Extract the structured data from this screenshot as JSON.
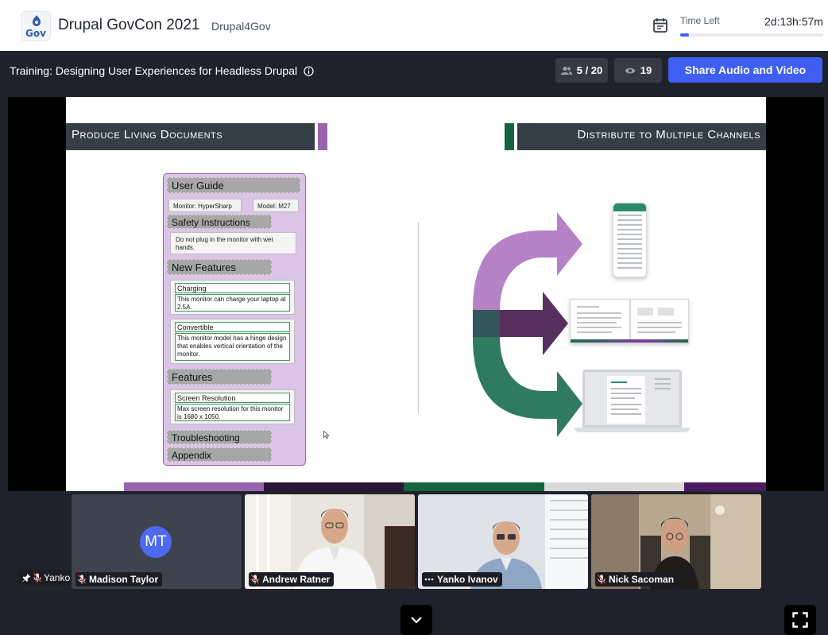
{
  "header": {
    "logo_text": "Gov",
    "event_title": "Drupal GovCon 2021",
    "organizer": "Drupal4Gov",
    "time_left_label": "Time Left",
    "time_left_value": "2d:13h:57m",
    "time_elapsed_fraction": 0.06
  },
  "session": {
    "title": "Training: Designing User Experiences for Headless Drupal",
    "participants": "5 / 20",
    "viewers": "19",
    "share_button": "Share Audio and Video"
  },
  "slide": {
    "left_heading": "Produce Living Documents",
    "right_heading": "Distribute to Multiple Channels",
    "doc": {
      "user_guide": "User Guide",
      "monitor_chip": "Monitor: HyperSharp",
      "model_chip": "Model: M27",
      "safety": "Safety Instructions",
      "safety_text": "Do not plug in the monitor with wet hands.",
      "new_features": "New Features",
      "charging_title": "Charging",
      "charging_text": "This monitor can charge your laptop at 2.5A.",
      "convertible_title": "Convertible",
      "convertible_text": "This monitor model has a hinge design that enables vertical orientation of the monitor.",
      "features": "Features",
      "resolution_title": "Screen Resolution",
      "resolution_text": "Max screen resolution for this monitor is 1680 x 1050.",
      "troubleshooting": "Troubleshooting",
      "appendix": "Appendix"
    },
    "colors": {
      "purple": "#9a63ad",
      "green": "#14653f",
      "dark": "#333f44"
    }
  },
  "stage_label": "Yanko Ivanov [Screenshare]",
  "participants": [
    {
      "name": "Madison Taylor",
      "initials": "MT",
      "indicator": "mic-muted-icon"
    },
    {
      "name": "Andrew Ratner",
      "indicator": "mic-muted-icon"
    },
    {
      "name": "Yanko Ivanov",
      "indicator": "speaking-dots-icon"
    },
    {
      "name": "Nick Sacoman",
      "indicator": "mic-muted-icon"
    }
  ]
}
